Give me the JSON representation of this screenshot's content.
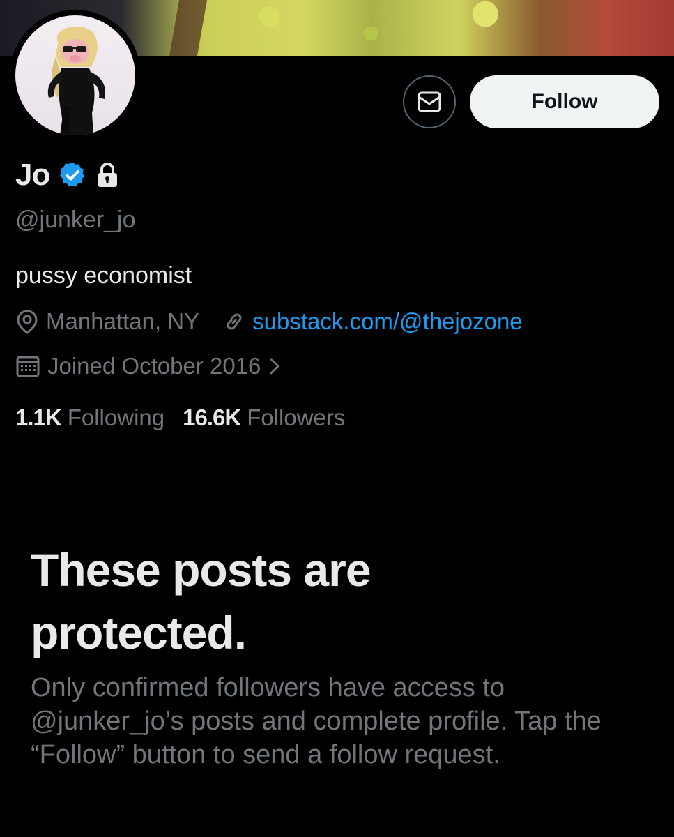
{
  "banner": {
    "icon": "cartoon-banner-image"
  },
  "profile": {
    "avatar_icon": "avatar-photo",
    "name": "Jo",
    "verified_icon": "verified-badge-icon",
    "lock_icon": "lock-icon",
    "handle": "@junker_jo",
    "bio": "pussy economist",
    "location": "Manhattan, NY",
    "location_icon": "location-pin-icon",
    "website": "substack.com/@thejozone",
    "website_icon": "link-icon",
    "joined": "Joined October 2016",
    "joined_icon": "calendar-icon",
    "joined_chevron": "chevron-right-icon"
  },
  "actions": {
    "message_icon": "envelope-icon",
    "follow_label": "Follow"
  },
  "stats": {
    "following_count": "1.1K",
    "following_label": "Following",
    "followers_count": "16.6K",
    "followers_label": "Followers"
  },
  "protected": {
    "title": "These posts are protected.",
    "description": "Only confirmed followers have access to @junker_jo’s posts and complete profile. Tap the “Follow” button to send a follow request."
  },
  "colors": {
    "background": "#000000",
    "text_primary": "#e7e9ea",
    "text_secondary": "#71767b",
    "link": "#1d9bf0",
    "verified": "#1d9bf0",
    "follow_button_bg": "#eff3f4"
  }
}
